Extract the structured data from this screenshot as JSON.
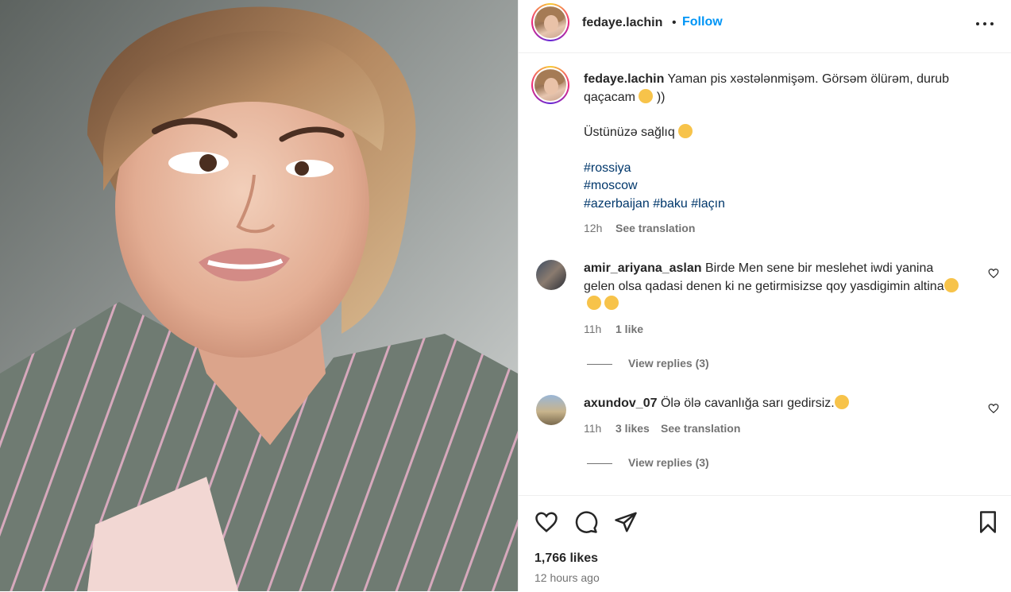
{
  "post": {
    "author": "fedaye.lachin",
    "follow_label": "Follow",
    "dot": "•",
    "caption_user": "fedaye.lachin",
    "caption_line1": "Yaman pis xəstələnmişəm. Görsəm ölürəm, durub qaçacam",
    "caption_line1_end": "))",
    "caption_line2": "Üstünüzə sağlıq",
    "hashtags_row1": [
      "#rossiya"
    ],
    "hashtags_row2": [
      "#moscow"
    ],
    "hashtags_row3": [
      "#azerbaijan",
      "#baku",
      "#laçın"
    ],
    "caption_time": "12h",
    "see_translation": "See translation"
  },
  "comments": [
    {
      "user": "amir_ariyana_aslan",
      "text": "Birde Men sene bir meslehet iwdi yanina gelen olsa qadasi denen ki ne getirmisizse qoy yasdigimin altina",
      "emojis": [
        "face-with-tears-of-joy",
        "face-with-tears-of-joy",
        "face-with-tears-of-joy"
      ],
      "time": "11h",
      "likes": "1 like",
      "view_replies": "View replies (3)"
    },
    {
      "user": "axundov_07",
      "text": "Ölə ölə cavanlığa sarı gedirsiz.",
      "emojis": [
        "face-with-tears-of-joy"
      ],
      "time": "11h",
      "likes": "3 likes",
      "see_translation": "See translation",
      "view_replies": "View replies (3)"
    }
  ],
  "footer": {
    "likes": "1,766 likes",
    "time_ago": "12 hours ago"
  },
  "icons": {
    "like": "heart-icon",
    "comment": "comment-icon",
    "share": "share-icon",
    "save": "bookmark-icon",
    "more": "more-horizontal-icon"
  },
  "colors": {
    "link": "#0095f6",
    "hashtag": "#00376b",
    "secondary_text": "#737373"
  }
}
